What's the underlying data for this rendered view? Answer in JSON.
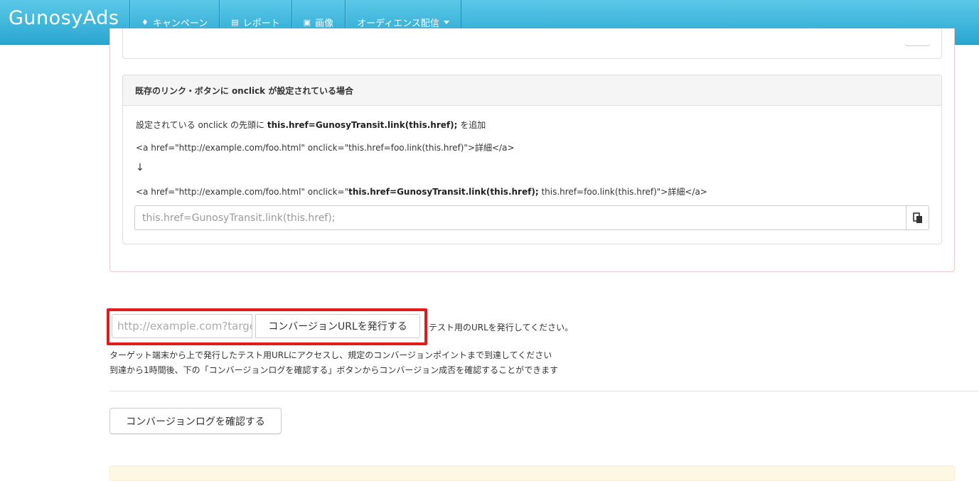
{
  "app": {
    "brand": "GunosyAds"
  },
  "nav": {
    "items": [
      {
        "label": "キャンペーン",
        "icon": "tag-icon"
      },
      {
        "label": "レポート",
        "icon": "list-alt-icon"
      },
      {
        "label": "画像",
        "icon": "picture-icon"
      },
      {
        "label": "オーディエンス配信",
        "icon": "caret-down-icon"
      }
    ]
  },
  "onclick_panel": {
    "heading": "既存のリンク・ボタンに onclick が設定されている場合",
    "line1_prefix": "設定されている onclick の先頭に ",
    "line1_bold": "this.href=GunosyTransit.link(this.href);",
    "line1_suffix": " を追加",
    "example_before": "<a href=\"http://example.com/foo.html\" onclick=\"this.href=foo.link(this.href)\">詳細</a>",
    "arrow": "↓",
    "example_after_prefix": "<a href=\"http://example.com/foo.html\" onclick=\"",
    "example_after_bold": "this.href=GunosyTransit.link(this.href);",
    "example_after_suffix": " this.href=foo.link(this.href)\">詳細</a>",
    "copy_value": "this.href=GunosyTransit.link(this.href);"
  },
  "conversion": {
    "url_placeholder": "http://example.com?target",
    "issue_button": "コンバージョンURLを発行する",
    "hint": "テスト用のURLを発行してください。",
    "desc_line1": "ターゲット端末から上で発行したテスト用URLにアクセスし、規定のコンバージョンポイントまで到達してください",
    "desc_line2": "到達から1時間後、下の「コンバージョンログを確認する」ボタンからコンバージョン成否を確認することができます",
    "log_button": "コンバージョンログを確認する"
  },
  "colors": {
    "navbar_top": "#5bc8e8",
    "navbar_bottom": "#29a6d0",
    "highlight": "#e01b1b",
    "alert_bg": "#fcf8e3"
  }
}
